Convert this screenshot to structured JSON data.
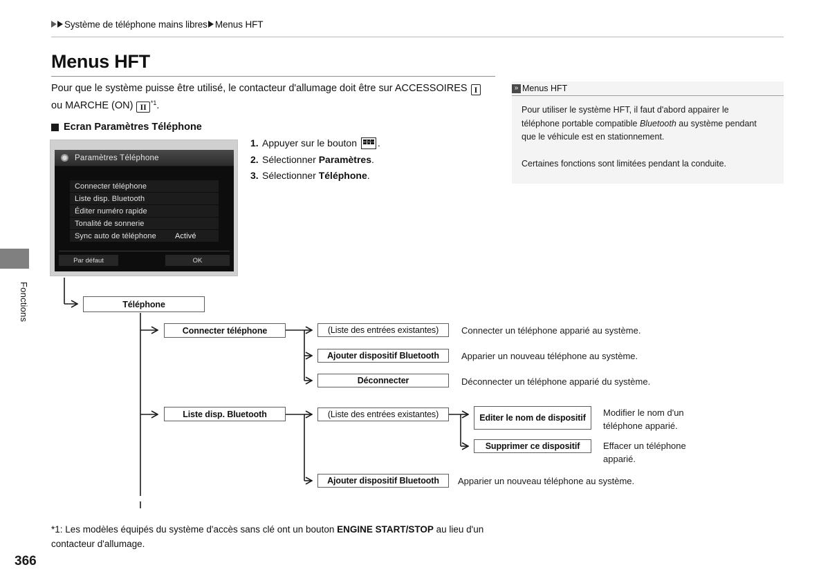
{
  "breadcrumb": {
    "part1": "Système de téléphone mains libres",
    "part2": "Menus HFT"
  },
  "side": {
    "tab_label": "Fonctions",
    "page_number": "366"
  },
  "page_title": "Menus HFT",
  "intro": {
    "line1_before": "Pour que le système puisse être utilisé, le contacteur d'allumage doit être sur ACCESSOIRES ",
    "key_accessory": "I",
    "line2_before": "ou MARCHE (ON) ",
    "key_on": "II",
    "footnote_marker": "*1",
    "line2_after": "."
  },
  "subheading": "Ecran Paramètres Téléphone",
  "device": {
    "title": "Paramètres Téléphone",
    "gear_icon": "gear-icon",
    "rows": [
      {
        "label": "Connecter téléphone",
        "value": ""
      },
      {
        "label": "Liste disp. Bluetooth",
        "value": ""
      },
      {
        "label": "Éditer numéro rapide",
        "value": ""
      },
      {
        "label": "Tonalité de sonnerie",
        "value": ""
      },
      {
        "label": "Sync auto de téléphone",
        "value": "Activé"
      }
    ],
    "button_default": "Par défaut",
    "button_ok": "OK"
  },
  "steps": [
    {
      "num": "1.",
      "before": "Appuyer sur le bouton ",
      "icon": "home-button-icon",
      "bold": "",
      "after": "."
    },
    {
      "num": "2.",
      "before": "Sélectionner ",
      "bold": "Paramètres",
      "after": "."
    },
    {
      "num": "3.",
      "before": "Sélectionner ",
      "bold": "Téléphone",
      "after": "."
    }
  ],
  "infobox": {
    "icon": "double-chevron-right-icon",
    "title": "Menus HFT",
    "para1_a": "Pour utiliser le système HFT, il faut d'abord appairer le téléphone portable compatible ",
    "para1_italic": "Bluetooth",
    "para1_b": " au système pendant que le véhicule est en stationnement.",
    "para2": "Certaines fonctions sont limitées pendant la conduite."
  },
  "flow": {
    "root": "Téléphone",
    "nodes": {
      "connecter": "Connecter téléphone",
      "liste_bt": "Liste disp. Bluetooth",
      "liste_entrees_1": "(Liste des entrées existantes)",
      "ajouter_bt_1": "Ajouter dispositif Bluetooth",
      "deconnecter": "Déconnecter",
      "liste_entrees_2": "(Liste des entrées existantes)",
      "editer_nom": "Editer le nom de dispositif",
      "supprimer": "Supprimer ce dispositif",
      "ajouter_bt_2": "Ajouter dispositif Bluetooth"
    },
    "labels": {
      "connecter_desc": "Connecter un téléphone apparié au système.",
      "ajouter_desc_1": "Apparier un nouveau téléphone au système.",
      "deconnecter_desc": "Déconnecter un téléphone apparié du système.",
      "editer_desc": "Modifier le nom d'un téléphone apparié.",
      "supprimer_desc": "Effacer un téléphone apparié.",
      "ajouter_desc_2": "Apparier un nouveau téléphone au système."
    }
  },
  "footnote": {
    "before": "*1: Les modèles équipés du système d'accès sans clé ont un bouton ",
    "bold": "ENGINE START/STOP",
    "after": " au lieu d'un contacteur d'allumage."
  },
  "colors": {
    "tab_gray": "#808080",
    "infobox_bg": "#f4f4f4",
    "device_bezel": "#d0d0d0",
    "device_screen": "#0d0d0d",
    "rule": "#b9b9b9"
  }
}
